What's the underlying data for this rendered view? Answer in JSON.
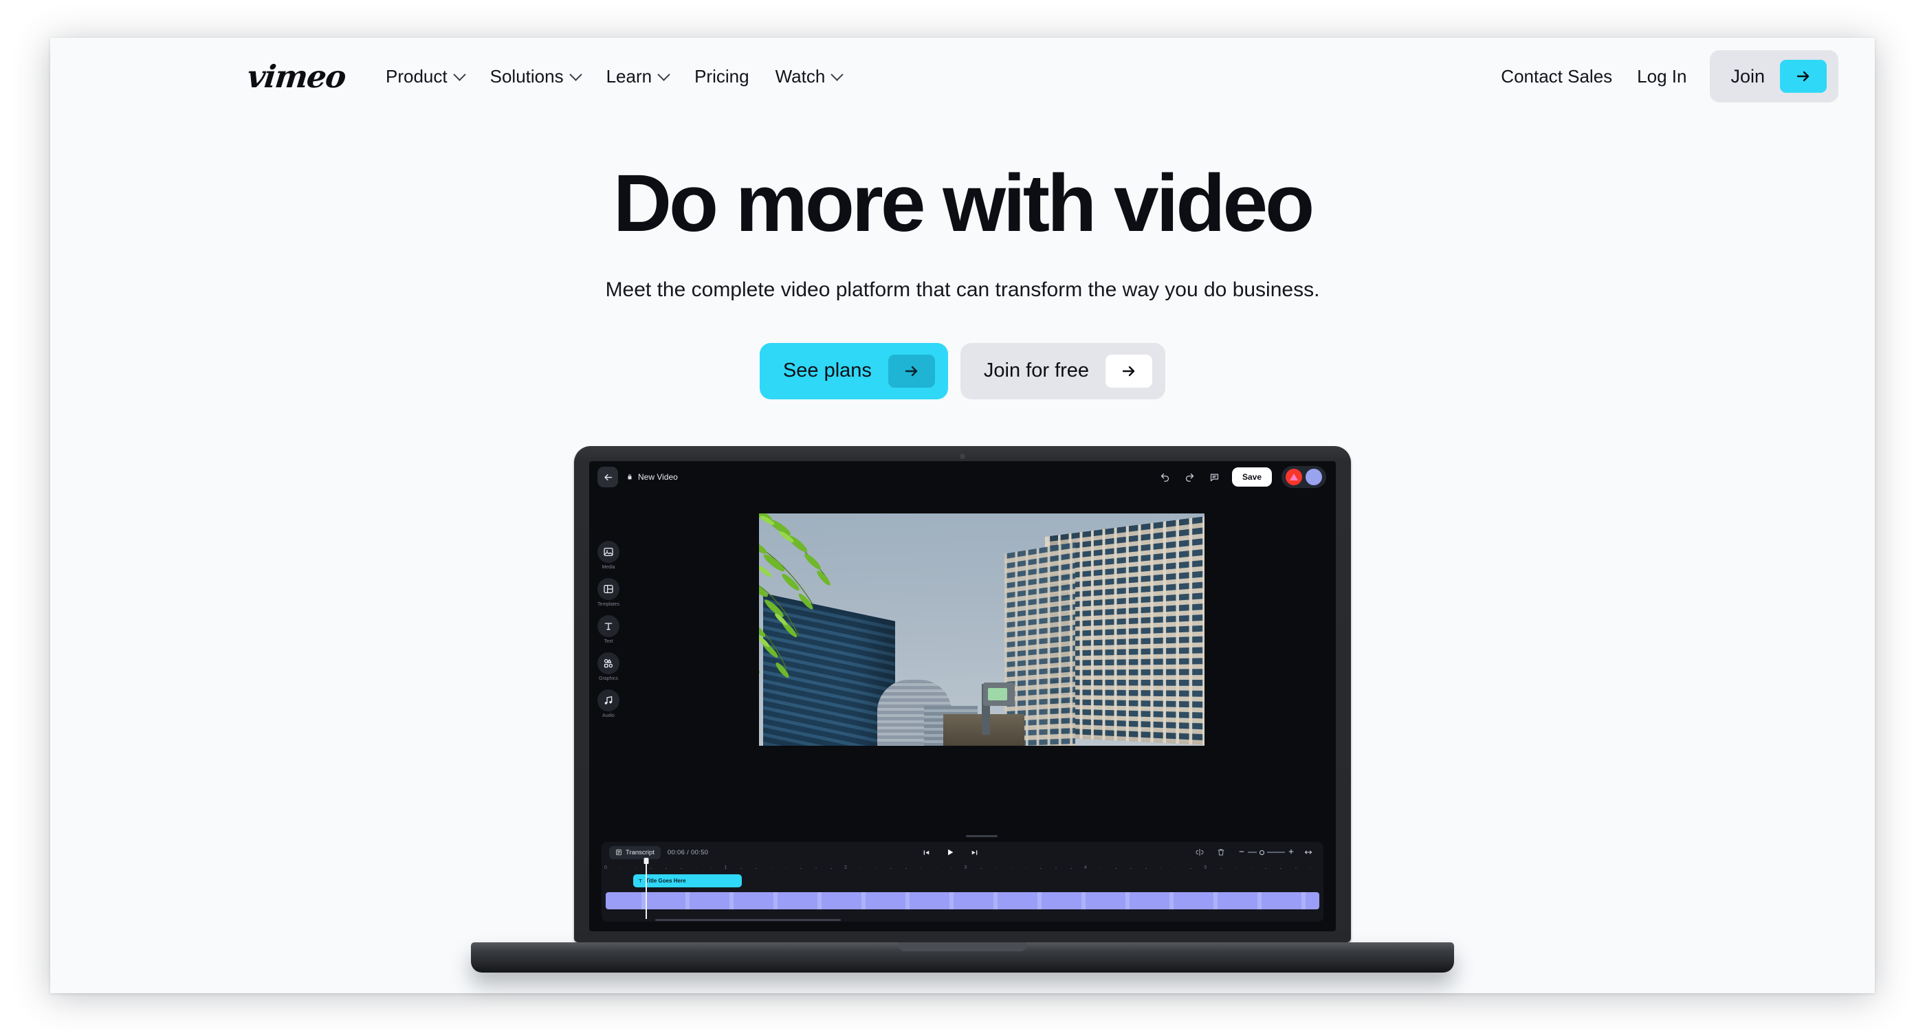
{
  "brand": {
    "logo_text": "vimeo",
    "accent_cyan": "#2fd8f7",
    "accent_cyan_dark": "#1fb4d4",
    "pill_gray": "#e3e5ea",
    "page_bg": "#f8fafc",
    "ink": "#0d0e14"
  },
  "header": {
    "nav_items": [
      {
        "label": "Product",
        "has_chevron": true
      },
      {
        "label": "Solutions",
        "has_chevron": true
      },
      {
        "label": "Learn",
        "has_chevron": true
      },
      {
        "label": "Pricing",
        "has_chevron": false
      },
      {
        "label": "Watch",
        "has_chevron": true
      }
    ],
    "contact_sales": "Contact Sales",
    "log_in": "Log In",
    "join": "Join",
    "join_arrow_icon": "arrow-right-icon"
  },
  "hero": {
    "title": "Do more with video",
    "subtitle": "Meet the complete video platform that can transform the way you do business.",
    "cta_primary": "See plans",
    "cta_secondary": "Join for free",
    "cta_arrow_icon": "arrow-right-icon"
  },
  "editor": {
    "back_icon": "arrow-left-icon",
    "lock_icon": "lock-icon",
    "doc_title": "New Video",
    "undo_icon": "undo-icon",
    "redo_icon": "redo-icon",
    "comment_icon": "comment-icon",
    "save_label": "Save",
    "avatars": [
      {
        "name": "avatar-red",
        "color": "#f8372a"
      },
      {
        "name": "avatar-purple",
        "color": "#9aa3ef"
      }
    ],
    "tools": [
      {
        "label": "Media",
        "icon": "image-icon"
      },
      {
        "label": "Templates",
        "icon": "layout-icon"
      },
      {
        "label": "Text",
        "icon": "text-t-icon"
      },
      {
        "label": "Graphics",
        "icon": "shapes-icon"
      },
      {
        "label": "Audio",
        "icon": "music-note-icon"
      }
    ],
    "preview": {
      "description": "Upward view of city skyscrapers with green tree foliage against an overcast blue-gray sky"
    },
    "timeline": {
      "transcript_label": "Transcript",
      "transcript_icon": "transcript-icon",
      "timecode_current": "00:06",
      "timecode_total": "00:50",
      "timecode_display": "00:06 / 00:50",
      "skip_back_icon": "skip-back-icon",
      "play_icon": "play-icon",
      "skip_forward_icon": "skip-forward-icon",
      "split_icon": "split-icon",
      "delete_icon": "trash-icon",
      "zoom_out_icon": "minus-icon",
      "zoom_in_icon": "plus-icon",
      "fit_icon": "fit-width-icon",
      "ruler_ticks": [
        "0",
        "1",
        "2",
        "3",
        "4",
        "5"
      ],
      "text_clip_label": "Title Goes Here",
      "text_clip_icon": "text-t-icon",
      "media_clip_name": "video-track"
    }
  }
}
